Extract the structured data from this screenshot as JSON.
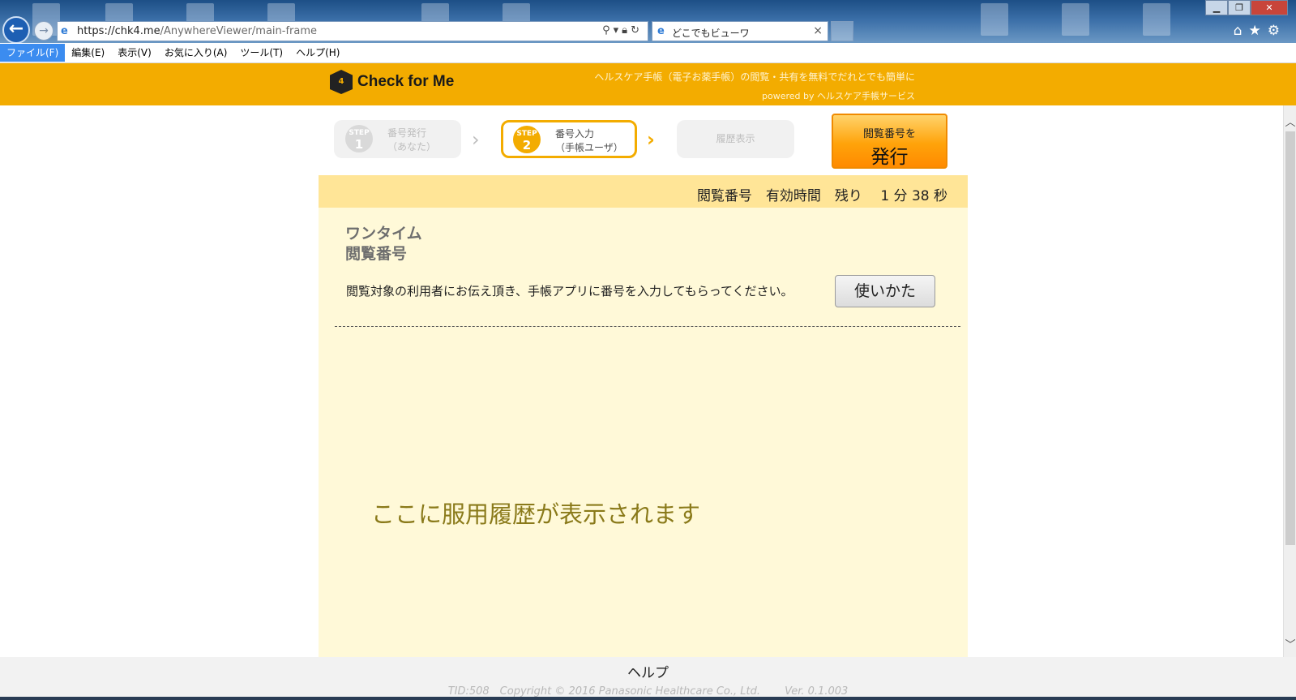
{
  "browser": {
    "address_prefix": "https://",
    "address_host": "chk4.me",
    "address_path": "/AnywhereViewer/main-frame",
    "tab_title": "どこでもビューワ"
  },
  "menu": {
    "items": [
      "ファイル(F)",
      "編集(E)",
      "表示(V)",
      "お気に入り(A)",
      "ツール(T)",
      "ヘルプ(H)"
    ],
    "active_index": 0
  },
  "header": {
    "logo_text": "Check for Me",
    "tagline": "ヘルスケア手帳（電子お薬手帳）の閲覧・共有を無料でだれとでも簡単に",
    "powered_by": "powered by ヘルスケア手帳サービス"
  },
  "steps": [
    {
      "badge_top": "STEP",
      "badge_num": "1",
      "line1": "番号発行",
      "line2": "（あなた）",
      "state": "done"
    },
    {
      "badge_top": "STEP",
      "badge_num": "2",
      "line1": "番号入力",
      "line2": "（手帳ユーザ）",
      "state": "current"
    },
    {
      "label": "履歴表示",
      "state": "pending"
    }
  ],
  "issue_button": {
    "line1": "閲覧番号を",
    "line2": "発行"
  },
  "timer": {
    "text": "閲覧番号　有効時間　残り　 1 分 38 秒"
  },
  "panel": {
    "title_line1": "ワンタイム",
    "title_line2": "閲覧番号",
    "instruction": "閲覧対象の利用者にお伝え頂き、手帳アプリに番号を入力してもらってください。",
    "howto_label": "使いかた",
    "placeholder": "ここに服用履歴が表示されます"
  },
  "footer": {
    "help": "ヘルプ",
    "copyright": "TID:508　Copyright © 2016 Panasonic Healthcare Co., Ltd.　　 Ver. 0.1.003"
  },
  "colors": {
    "brand_orange": "#f3ac00",
    "panel_bg": "#fff9d8",
    "timer_bg": "#ffe597"
  }
}
